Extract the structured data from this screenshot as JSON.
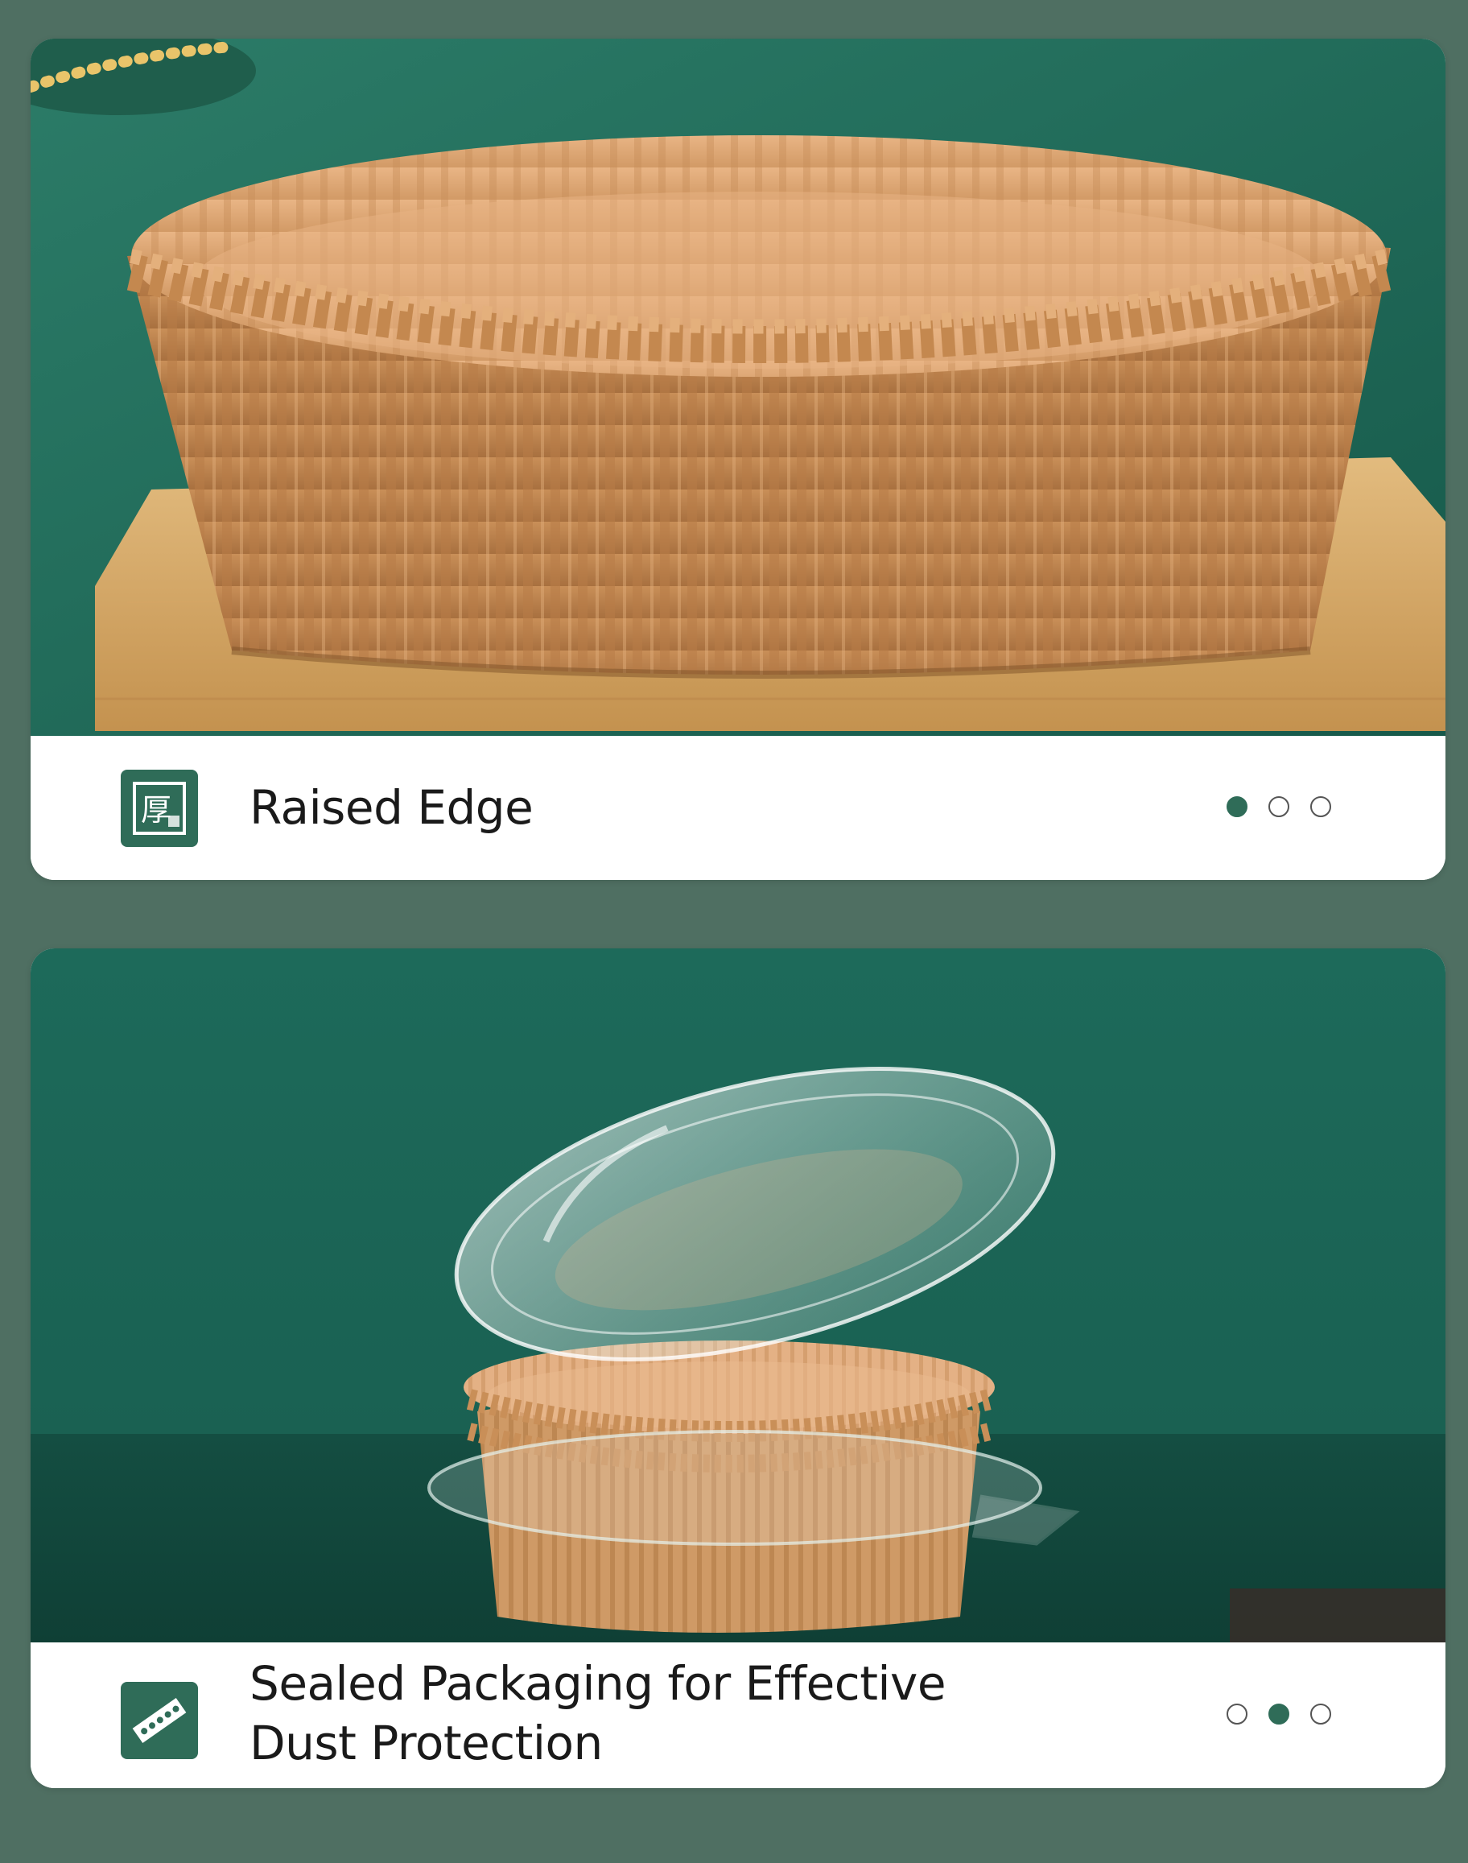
{
  "slides": [
    {
      "icon": "thick-paper-icon",
      "icon_glyph": "厚",
      "title": "Raised Edge",
      "photo": "round-parchment-air-fryer-liner-on-wooden-board",
      "active_dot": 1
    },
    {
      "icon": "perforated-strip-icon",
      "title": "Sealed Packaging for Effective Dust Protection",
      "photo": "liners-in-clear-plastic-container-with-lid",
      "active_dot": 2
    }
  ],
  "colors": {
    "page_background": "#4f6f62",
    "accent": "#2f6c58",
    "photo_background": "#1f6a5a",
    "paper": "#d9a878"
  }
}
